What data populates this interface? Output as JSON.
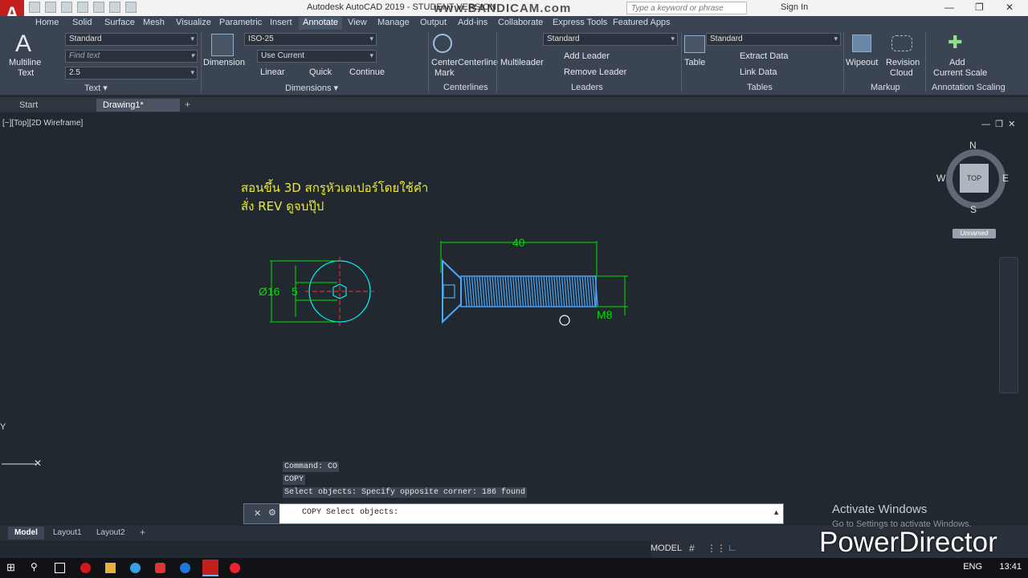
{
  "app": {
    "title": "Autodesk AutoCAD 2019 - STUDENT VERSION",
    "watermark": "www.BANDICAM.com",
    "logo": "A",
    "search_placeholder": "Type a keyword or phrase",
    "sign_in": "Sign In"
  },
  "tabs": [
    "Home",
    "Solid",
    "Surface",
    "Mesh",
    "Visualize",
    "Parametric",
    "Insert",
    "Annotate",
    "View",
    "Manage",
    "Output",
    "Add-ins",
    "Collaborate",
    "Express Tools",
    "Featured Apps"
  ],
  "ribbon": {
    "text": {
      "multiline_l1": "Multiline",
      "multiline_l2": "Text",
      "style": "Standard",
      "find_placeholder": "Find text",
      "height": "2.5",
      "title": "Text ▾"
    },
    "dimensions": {
      "dimension": "Dimension",
      "style": "ISO-25",
      "layer": "Use Current",
      "linear": "Linear",
      "quick": "Quick",
      "continue": "Continue",
      "title": "Dimensions ▾"
    },
    "centerlines": {
      "center_l1": "Center",
      "center_l2": "Mark",
      "centerline": "Centerline",
      "title": "Centerlines"
    },
    "leaders": {
      "multileader": "Multileader",
      "style": "Standard",
      "add": "Add Leader",
      "remove": "Remove Leader",
      "title": "Leaders"
    },
    "tables": {
      "table": "Table",
      "style": "Standard",
      "extract": "Extract Data",
      "link": "Link Data",
      "title": "Tables"
    },
    "markup": {
      "wipeout": "Wipeout",
      "revision_l1": "Revision",
      "revision_l2": "Cloud",
      "title": "Markup"
    },
    "scaling": {
      "add_l1": "Add",
      "add_l2": "Current Scale",
      "title": "Annotation Scaling"
    }
  },
  "file_tabs": [
    "Start",
    "Drawing1*"
  ],
  "viewport": {
    "label": "[−][Top][2D Wireframe]",
    "caption_line1": "สอนขึ้น 3D สกรูหัวเตเปอร์โดยใช้คำ",
    "caption_line2": "สั่ง REV ดูจบปุ๊ป",
    "ucs_y": "Y"
  },
  "viewcube": {
    "n": "N",
    "s": "S",
    "e": "E",
    "w": "W",
    "top": "TOP",
    "unnamed": "Unnamed"
  },
  "drawing": {
    "dim_length": "40",
    "dim_diameter": "Ø16",
    "dim_5": "5",
    "dim_thread": "M8"
  },
  "command": {
    "history": [
      "Command: CO",
      "COPY",
      "Select objects: Specify opposite corner: 186 found"
    ],
    "current": "COPY Select objects:"
  },
  "layouts": [
    "Model",
    "Layout1",
    "Layout2"
  ],
  "status": {
    "model": "MODEL"
  },
  "overlay": {
    "activate_title": "Activate Windows",
    "activate_sub": "Go to Settings to activate Windows.",
    "recorder": "PowerDirector"
  },
  "taskbar": {
    "lang": "ENG",
    "time": "13:41"
  },
  "colors": {
    "accent": "#00c8ff",
    "drawing_cyan": "#00ffff",
    "dim_green": "#00e000",
    "thread_blue": "#4aa8ff",
    "caption_yellow": "#ece93a"
  }
}
